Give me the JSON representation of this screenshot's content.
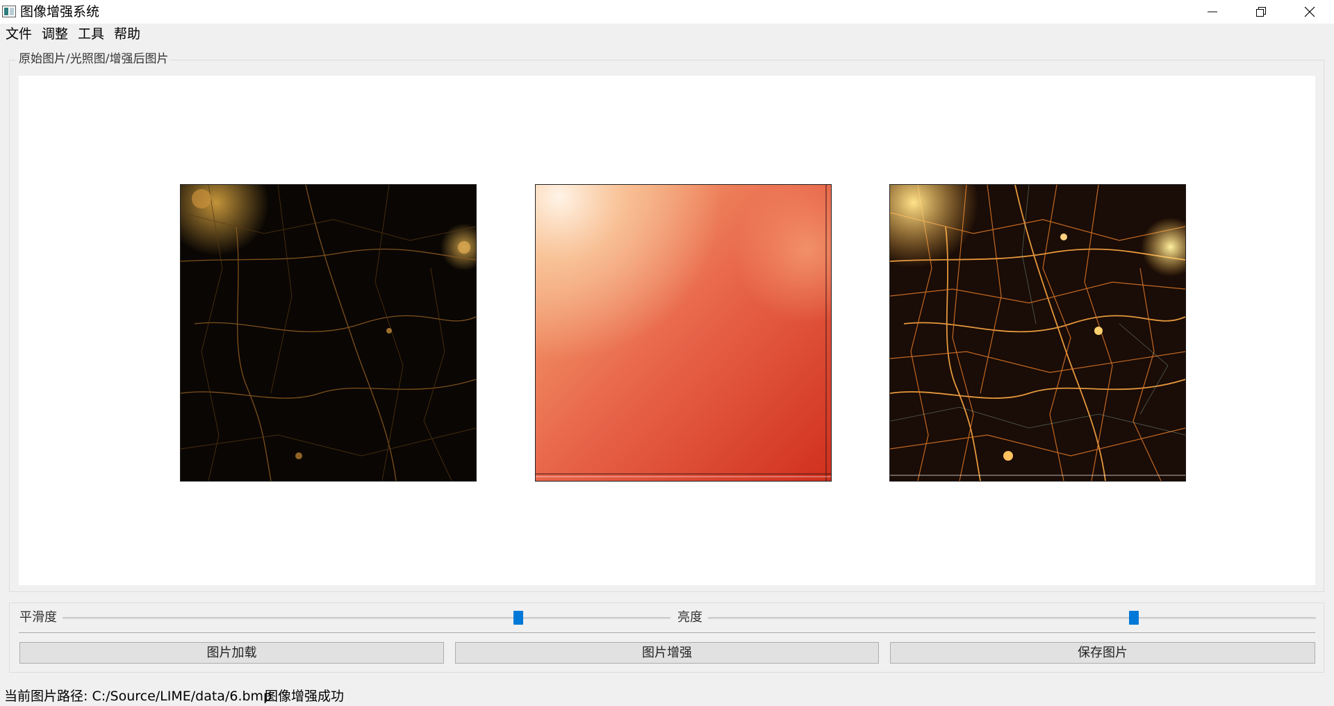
{
  "window": {
    "title": "图像增强系统"
  },
  "menu": {
    "items": [
      "文件",
      "调整",
      "工具",
      "帮助"
    ]
  },
  "image_group": {
    "title": "原始图片/光照图/增强后图片"
  },
  "controls": {
    "smoothness": {
      "label": "平滑度",
      "value_fraction": 0.75
    },
    "brightness": {
      "label": "亮度",
      "value_fraction": 0.7
    },
    "buttons": [
      "图片加载",
      "图片增强",
      "保存图片"
    ]
  },
  "status": {
    "path": "当前图片路径: C:/Source/LIME/data/6.bmp",
    "message": "图像增强成功"
  },
  "colors": {
    "accent": "#0078d7",
    "window_bg": "#f0f0f0"
  },
  "icons": {
    "minimize": "minimize-icon",
    "restore": "restore-icon",
    "close": "close-icon",
    "app": "app-icon"
  }
}
